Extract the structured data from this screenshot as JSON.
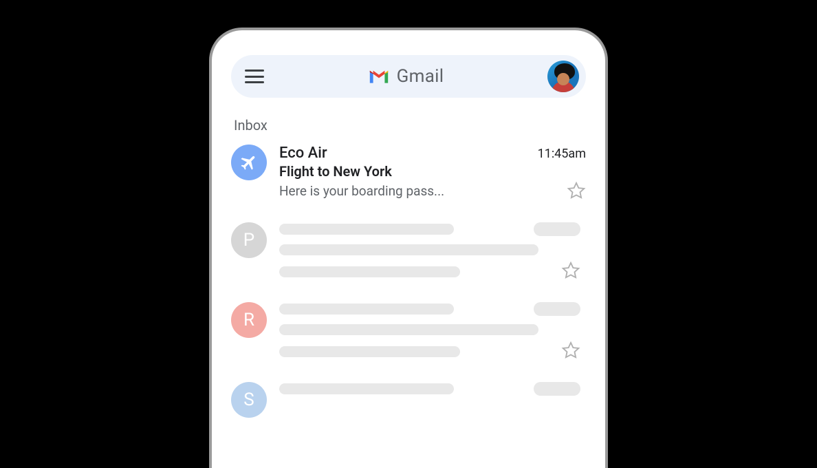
{
  "header": {
    "brand_name": "Gmail"
  },
  "section": {
    "label": "Inbox"
  },
  "emails": [
    {
      "sender": "Eco Air",
      "subject": "Flight to New York",
      "snippet": "Here is your boarding pass...",
      "time": "11:45am",
      "icon": "airplane",
      "badge_color": "blue",
      "starred": false
    },
    {
      "sender_initial": "P",
      "badge_color": "gray",
      "placeholder": true,
      "starred": false
    },
    {
      "sender_initial": "R",
      "badge_color": "red",
      "placeholder": true,
      "starred": false
    },
    {
      "sender_initial": "S",
      "badge_color": "lightblue",
      "placeholder": true,
      "starred": false
    }
  ]
}
